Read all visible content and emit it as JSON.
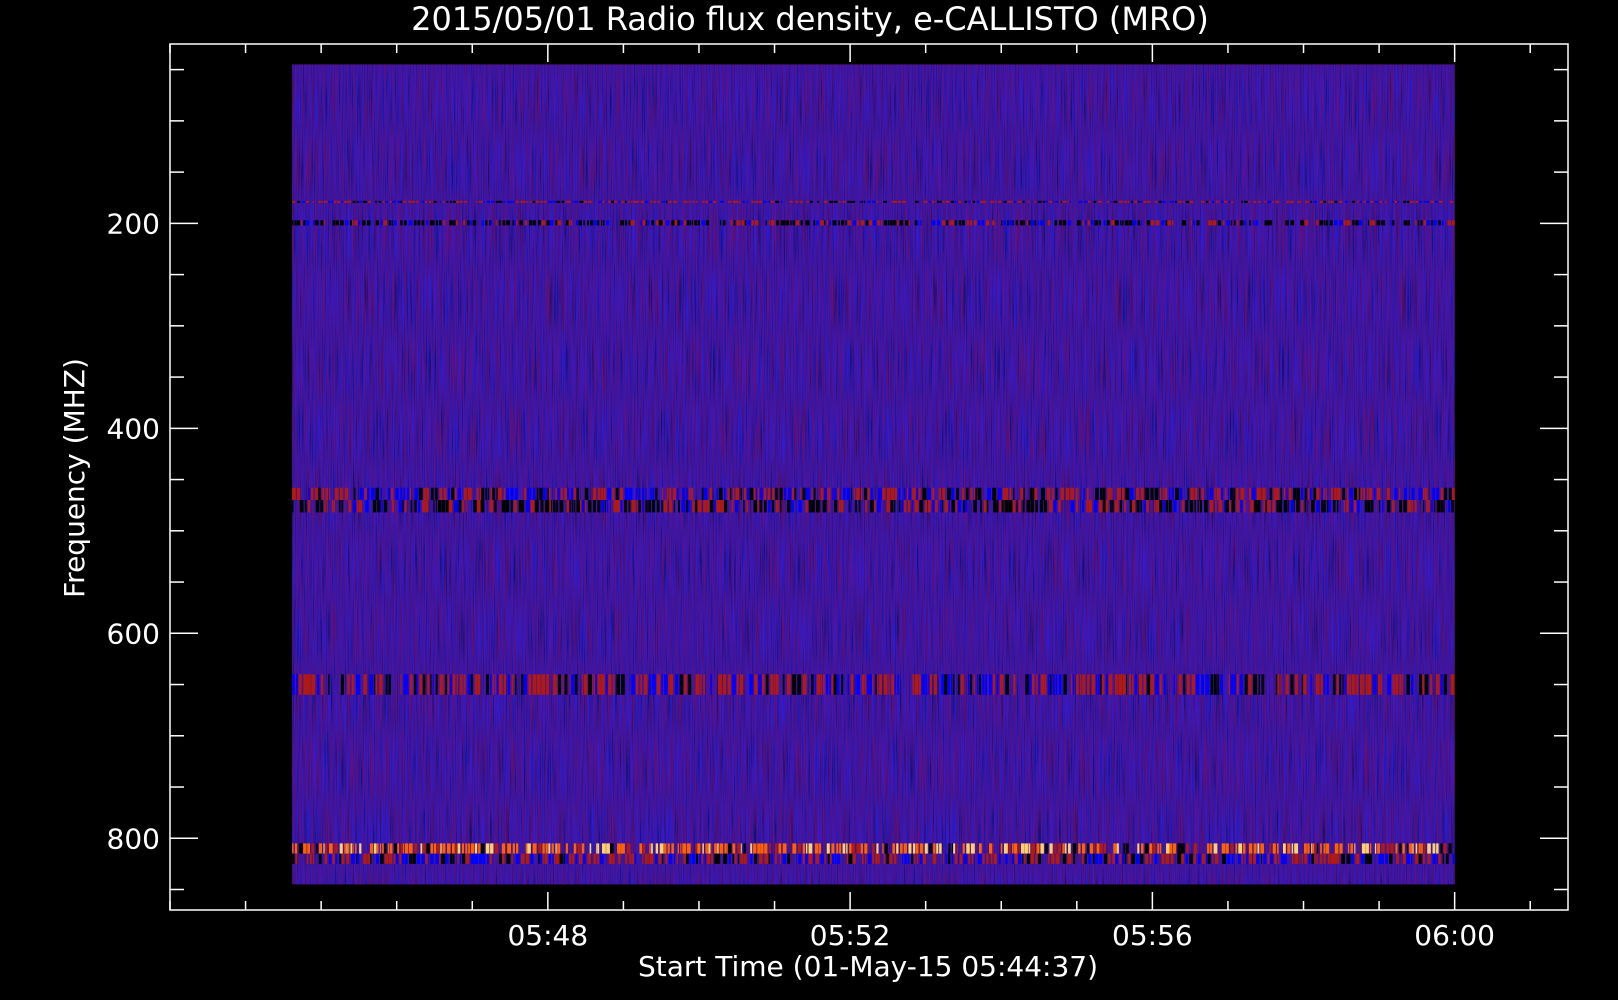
{
  "chart_data": {
    "type": "heatmap",
    "title": "2015/05/01  Radio flux density, e-CALLISTO (MRO)",
    "xlabel": "Start Time (01-May-15 05:44:37)",
    "ylabel": "Frequency (MHZ)",
    "x_range": [
      "05:44:37",
      "06:00:00"
    ],
    "x_axis_range": [
      "05:43:00",
      "06:01:30"
    ],
    "x_ticks": [
      "05:48",
      "05:52",
      "05:56",
      "06:00"
    ],
    "y_range": [
      45,
      845
    ],
    "y_axis_range": [
      25,
      870
    ],
    "y_inverted": true,
    "y_ticks": [
      200,
      400,
      600,
      800
    ],
    "colormap": [
      "#000000",
      "#0000ff",
      "#b01a10",
      "#ff6000",
      "#ffd070"
    ],
    "dominant_color": "#2020f0",
    "features": [
      {
        "freq_mhz": [
          178,
          180
        ],
        "level": "moderate"
      },
      {
        "freq_mhz": [
          197,
          202
        ],
        "level": "dark"
      },
      {
        "freq_mhz": [
          458,
          470
        ],
        "level": "moderate"
      },
      {
        "freq_mhz": [
          470,
          482
        ],
        "level": "dark"
      },
      {
        "freq_mhz": [
          640,
          660
        ],
        "level": "moderate"
      },
      {
        "freq_mhz": [
          805,
          815
        ],
        "level": "strong"
      },
      {
        "freq_mhz": [
          815,
          825
        ],
        "level": "moderate"
      }
    ]
  }
}
